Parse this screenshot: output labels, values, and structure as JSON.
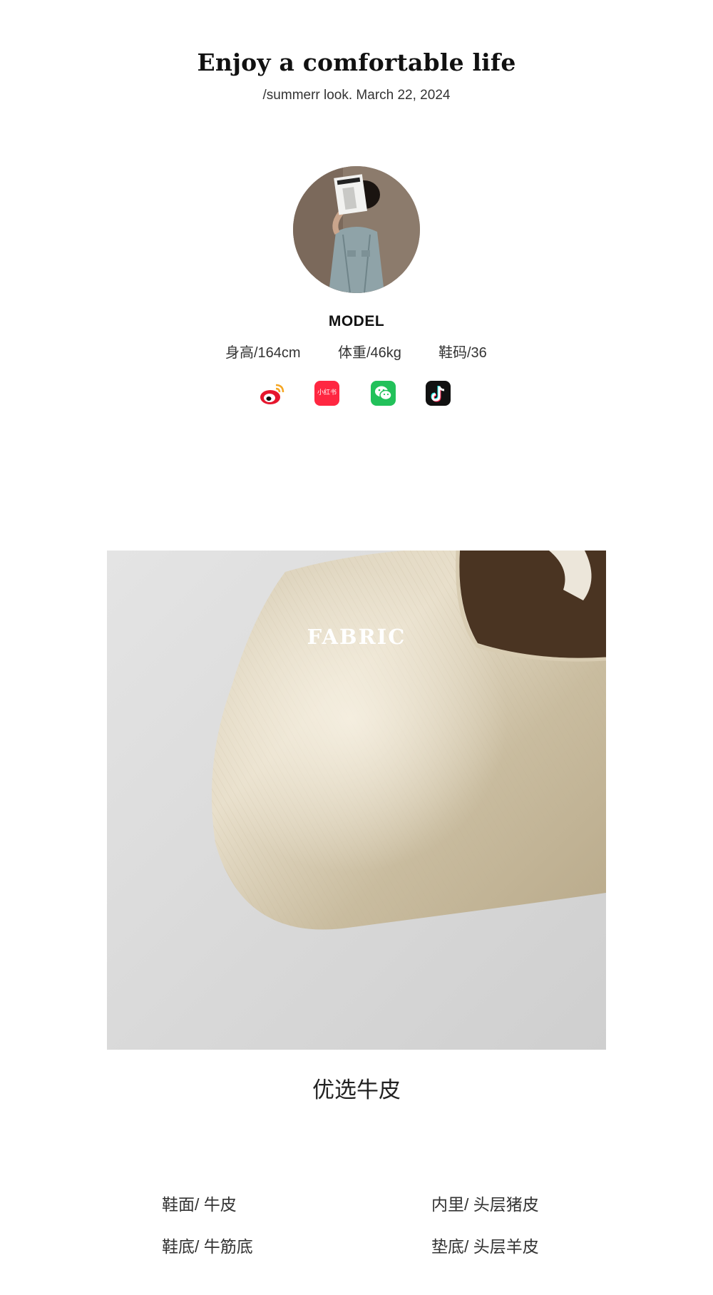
{
  "header": {
    "title": "Enjoy a comfortable life",
    "subtitle": "/summerr look. March 22, 2024"
  },
  "model": {
    "label": "MODEL",
    "height": "身高/164cm",
    "weight": "体重/46kg",
    "shoe_size": "鞋码/36"
  },
  "social": {
    "icons": [
      "weibo-icon",
      "xiaohongshu-icon",
      "wechat-icon",
      "douyin-icon"
    ],
    "xiaohongshu_text": "小红书",
    "colors": {
      "weibo": "#e6162d",
      "xiaohongshu": "#ff2741",
      "wechat": "#22c15a",
      "douyin": "#111111"
    }
  },
  "fabric": {
    "label": "FABRIC",
    "caption": "优选牛皮"
  },
  "specs": [
    "鞋面/ 牛皮",
    "内里/ 头层猪皮",
    "鞋底/ 牛筋底",
    "垫底/ 头层羊皮"
  ]
}
